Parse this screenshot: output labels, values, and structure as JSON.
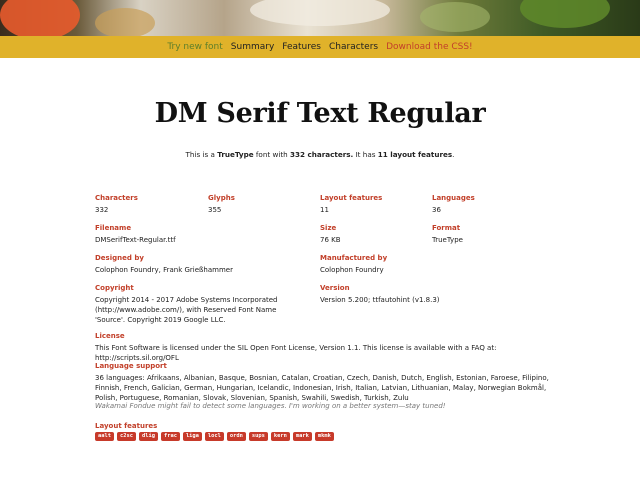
{
  "nav": {
    "try": "Try new font",
    "summary": "Summary",
    "features": "Features",
    "characters": "Characters",
    "download": "Download the CSS!"
  },
  "title": "DM Serif Text Regular",
  "summary": {
    "prefix": "This is a ",
    "format": "TrueType",
    "mid": " font with ",
    "chars": "332 characters.",
    "mid2": " It has ",
    "features": "11 layout features",
    "end": "."
  },
  "stats": {
    "characters": {
      "label": "Characters",
      "value": "332"
    },
    "glyphs": {
      "label": "Glyphs",
      "value": "355"
    },
    "layout": {
      "label": "Layout features",
      "value": "11"
    },
    "languages": {
      "label": "Languages",
      "value": "36"
    }
  },
  "file": {
    "filename": {
      "label": "Filename",
      "value": "DMSerifText-Regular.ttf"
    },
    "size": {
      "label": "Size",
      "value": "76 KB"
    },
    "format": {
      "label": "Format",
      "value": "TrueType"
    }
  },
  "people": {
    "designed": {
      "label": "Designed by",
      "value": "Colophon Foundry, Frank Grießhammer"
    },
    "manufactured": {
      "label": "Manufactured by",
      "value": "Colophon Foundry"
    }
  },
  "meta": {
    "copyright": {
      "label": "Copyright",
      "value": "Copyright 2014 - 2017 Adobe Systems Incorporated (http://www.adobe.com/), with Reserved Font Name 'Source'. Copyright 2019 Google LLC."
    },
    "version": {
      "label": "Version",
      "value": "Version 5.200; ttfautohint (v1.8.3)"
    }
  },
  "license": {
    "label": "License",
    "value": "This Font Software is licensed under the SIL Open Font License, Version 1.1. This license is available with a FAQ at: http://scripts.sil.org/OFL"
  },
  "language_support": {
    "label": "Language support",
    "value": "36 languages: Afrikaans, Albanian, Basque, Bosnian, Catalan, Croatian, Czech, Danish, Dutch, English, Estonian, Faroese, Filipino, Finnish, French, Galician, German, Hungarian, Icelandic, Indonesian, Irish, Italian, Latvian, Lithuanian, Malay, Norwegian Bokmål, Polish, Portuguese, Romanian, Slovak, Slovenian, Spanish, Swahili, Swedish, Turkish, Zulu",
    "note": "Wakamai Fondue might fail to detect some languages. I'm working on a better system—stay tuned!"
  },
  "layout_features": {
    "label": "Layout features",
    "tags": [
      "aalt",
      "c2sc",
      "dlig",
      "frac",
      "liga",
      "locl",
      "ordn",
      "sups",
      "kern",
      "mark",
      "mkmk"
    ]
  },
  "colors": {
    "accent": "#c2402a",
    "nav_bg": "#e0b22a",
    "tag_bg": "#c73a2a"
  }
}
